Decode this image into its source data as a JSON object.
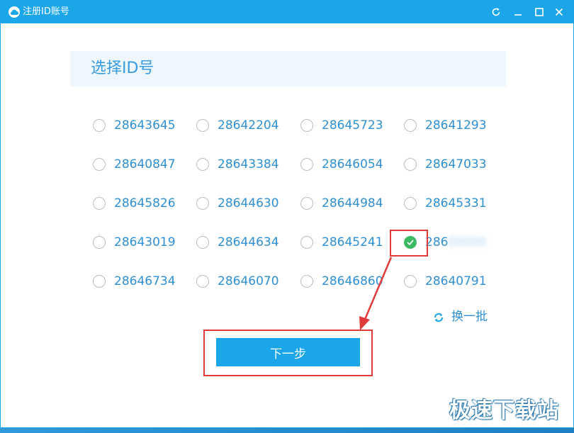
{
  "window": {
    "title": "注册ID账号",
    "accent_color": "#1ba6ea",
    "controls": [
      "refresh-icon",
      "minimize-icon",
      "maximize-icon",
      "close-icon"
    ]
  },
  "header": {
    "title": "选择ID号"
  },
  "id_options": [
    [
      "28643645",
      "28642204",
      "28645723",
      "28641293"
    ],
    [
      "28640847",
      "28643384",
      "28646054",
      "28647033"
    ],
    [
      "28645826",
      "28644630",
      "28644984",
      "28645331"
    ],
    [
      "28643019",
      "28644634",
      "28645241",
      "286"
    ],
    [
      "28646734",
      "28646070",
      "28646860",
      "28640791"
    ]
  ],
  "selected": {
    "row": 4,
    "column": 4,
    "partial_visible_text": "286",
    "check_color": "#3cba63"
  },
  "refresh": {
    "label": "换一批",
    "icon": "refresh-icon"
  },
  "next_button": {
    "label": "下一步"
  },
  "annotation": {
    "color": "#e03b3b"
  },
  "watermark": {
    "text": "极速下载站"
  }
}
